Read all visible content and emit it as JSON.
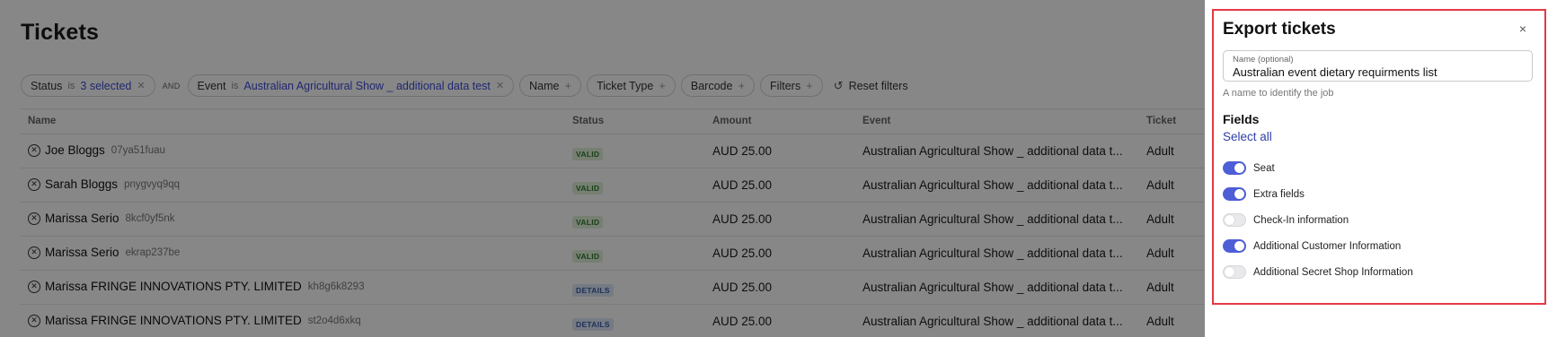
{
  "page": {
    "title": "Tickets"
  },
  "filters": {
    "status": {
      "label": "Status",
      "op": "is",
      "value": "3 selected"
    },
    "and_label": "AND",
    "event": {
      "label": "Event",
      "op": "is",
      "value": "Australian Agricultural Show _ additional data test"
    },
    "name": "Name",
    "ticket_type": "Ticket Type",
    "barcode": "Barcode",
    "more": "Filters",
    "reset": "Reset filters"
  },
  "table": {
    "headers": {
      "name": "Name",
      "status": "Status",
      "amount": "Amount",
      "event": "Event",
      "ticket": "Ticket"
    },
    "rows": [
      {
        "name": "Joe Bloggs",
        "code": "07ya51fuau",
        "status": "VALID",
        "amount": "AUD 25.00",
        "event": "Australian Agricultural Show _ additional data t...",
        "ticket": "Adult"
      },
      {
        "name": "Sarah Bloggs",
        "code": "pnygvyq9qq",
        "status": "VALID",
        "amount": "AUD 25.00",
        "event": "Australian Agricultural Show _ additional data t...",
        "ticket": "Adult"
      },
      {
        "name": "Marissa Serio",
        "code": "8kcf0yf5nk",
        "status": "VALID",
        "amount": "AUD 25.00",
        "event": "Australian Agricultural Show _ additional data t...",
        "ticket": "Adult"
      },
      {
        "name": "Marissa Serio",
        "code": "ekrap237be",
        "status": "VALID",
        "amount": "AUD 25.00",
        "event": "Australian Agricultural Show _ additional data t...",
        "ticket": "Adult"
      },
      {
        "name": "Marissa FRINGE INNOVATIONS PTY. LIMITED",
        "code": "kh8g6k8293",
        "status": "DETAILS",
        "amount": "AUD 25.00",
        "event": "Australian Agricultural Show _ additional data t...",
        "ticket": "Adult"
      },
      {
        "name": "Marissa FRINGE INNOVATIONS PTY. LIMITED",
        "code": "st2o4d6xkq",
        "status": "DETAILS",
        "amount": "AUD 25.00",
        "event": "Australian Agricultural Show _ additional data t...",
        "ticket": "Adult"
      }
    ]
  },
  "panel": {
    "title": "Export tickets",
    "close_icon": "×",
    "name_field": {
      "label": "Name (optional)",
      "value": "Australian event dietary requirments list"
    },
    "helper": "A name to identify the job",
    "fields_title": "Fields",
    "select_all": "Select all",
    "toggles": [
      {
        "label": "Seat",
        "on": true
      },
      {
        "label": "Extra fields",
        "on": true
      },
      {
        "label": "Check-In information",
        "on": false
      },
      {
        "label": "Additional Customer Information",
        "on": true
      },
      {
        "label": "Additional Secret Shop Information",
        "on": false
      }
    ]
  },
  "colors": {
    "accent": "#4e5ed8",
    "highlight_border": "#e53945",
    "overlay": "rgba(0,0,0,0.47)"
  }
}
